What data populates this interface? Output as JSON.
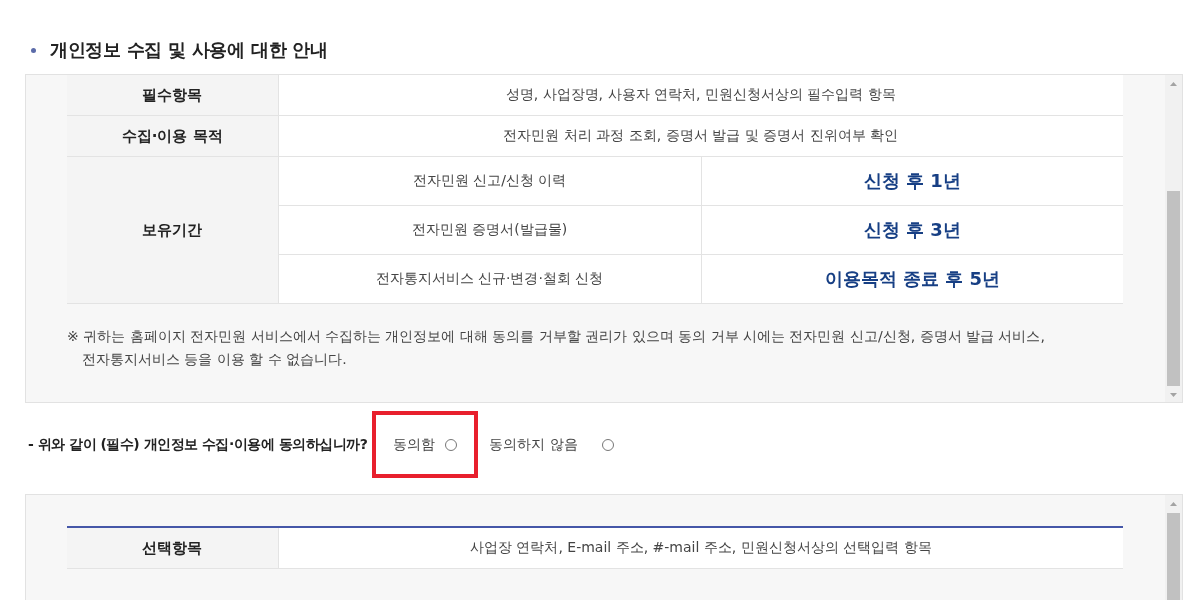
{
  "guide": {
    "title": "개인정보 수집 및 사용에 대한 안내"
  },
  "required_info": {
    "rows": [
      {
        "kind": "single",
        "heading": "필수항목",
        "value": "성명, 사업장명, 사용자 연락처, 민원신청서상의 필수입력 항목"
      },
      {
        "kind": "single",
        "heading": "수집·이용 목적",
        "value": "전자민원 처리 과정 조회, 증명서 발급 및 증명서 진위여부 확인"
      },
      {
        "kind": "split",
        "heading": "보유기간",
        "items": [
          {
            "record": "전자민원 신고/신청 이력",
            "period": "신청 후 1년"
          },
          {
            "record": "전자민원 증명서(발급물)",
            "period": "신청 후 3년"
          },
          {
            "record": "전자통지서비스 신규·변경·철회 신청",
            "period": "이용목적 종료 후 5년"
          }
        ]
      }
    ],
    "notice": "※ 귀하는 홈페이지 전자민원 서비스에서 수집하는 개인정보에 대해 동의를 거부할 권리가 있으며 동의 거부 시에는 전자민원 신고/신청, 증명서 발급 서비스,\n전자통지서비스 등을 이용 할 수 없습니다."
  },
  "consent": {
    "question": "- 위와 같이 (필수) 개인정보 수집·이용에 동의하십니까?",
    "options": [
      {
        "label": "동의함",
        "selected": false,
        "highlighted": true
      },
      {
        "label": "동의하지 않음",
        "selected": false,
        "highlighted": false
      }
    ]
  },
  "optional_info": {
    "rows": [
      {
        "kind": "single",
        "heading": "선택항목",
        "value": "사업장 연락처, E-mail 주소, #-mail 주소, 민원신청서상의 선택입력 항목"
      }
    ]
  }
}
